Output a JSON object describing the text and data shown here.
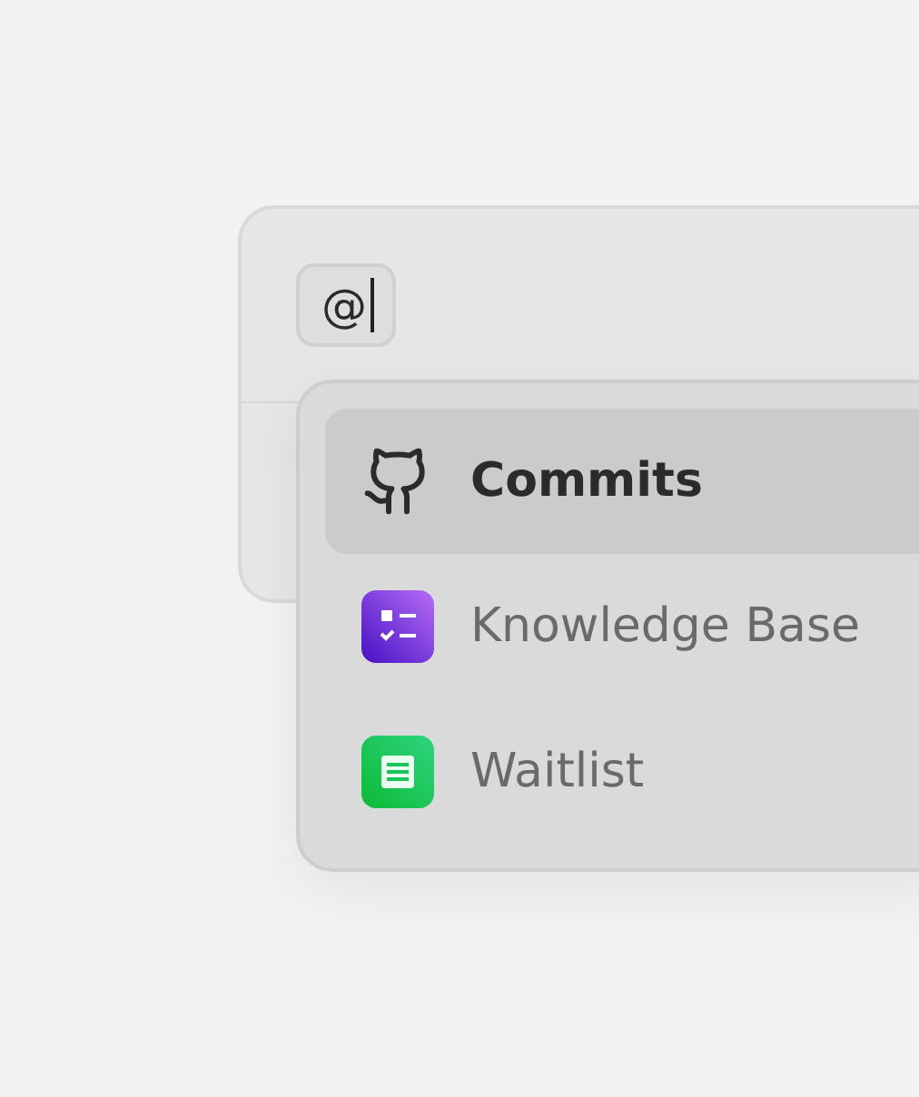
{
  "composer": {
    "mention": {
      "value": "@"
    }
  },
  "menu": {
    "items": [
      {
        "label": "Commits",
        "kind": "github",
        "selected": true
      },
      {
        "label": "Knowledge Base",
        "kind": "checklist",
        "selected": false
      },
      {
        "label": "Waitlist",
        "kind": "document",
        "selected": false
      }
    ]
  }
}
